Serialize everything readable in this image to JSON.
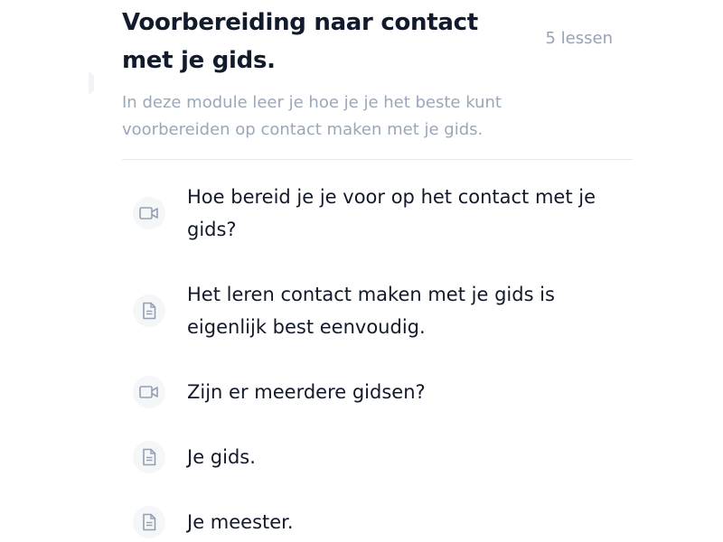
{
  "module": {
    "title": "Voorbereiding naar contact met je gids.",
    "lesson_count": "5 lessen",
    "description": "In deze module leer je hoe je je het beste kunt voorbereiden op contact maken met je gids."
  },
  "lessons": [
    {
      "title": "Hoe bereid je je voor op het contact met je gids?",
      "icon": "video-icon"
    },
    {
      "title": "Het leren contact maken met je gids is eigenlijk best eenvoudig.",
      "icon": "document-icon"
    },
    {
      "title": "Zijn er meerdere gidsen?",
      "icon": "video-icon"
    },
    {
      "title": "Je gids.",
      "icon": "document-icon"
    },
    {
      "title": "Je meester.",
      "icon": "document-icon"
    }
  ],
  "colors": {
    "title": "#111b2b",
    "muted": "#9aa7b9",
    "lesson_text": "#121a2a",
    "icon": "#94a0b2",
    "icon_bg": "#f4f6f8",
    "divider": "#e6e9ee"
  }
}
